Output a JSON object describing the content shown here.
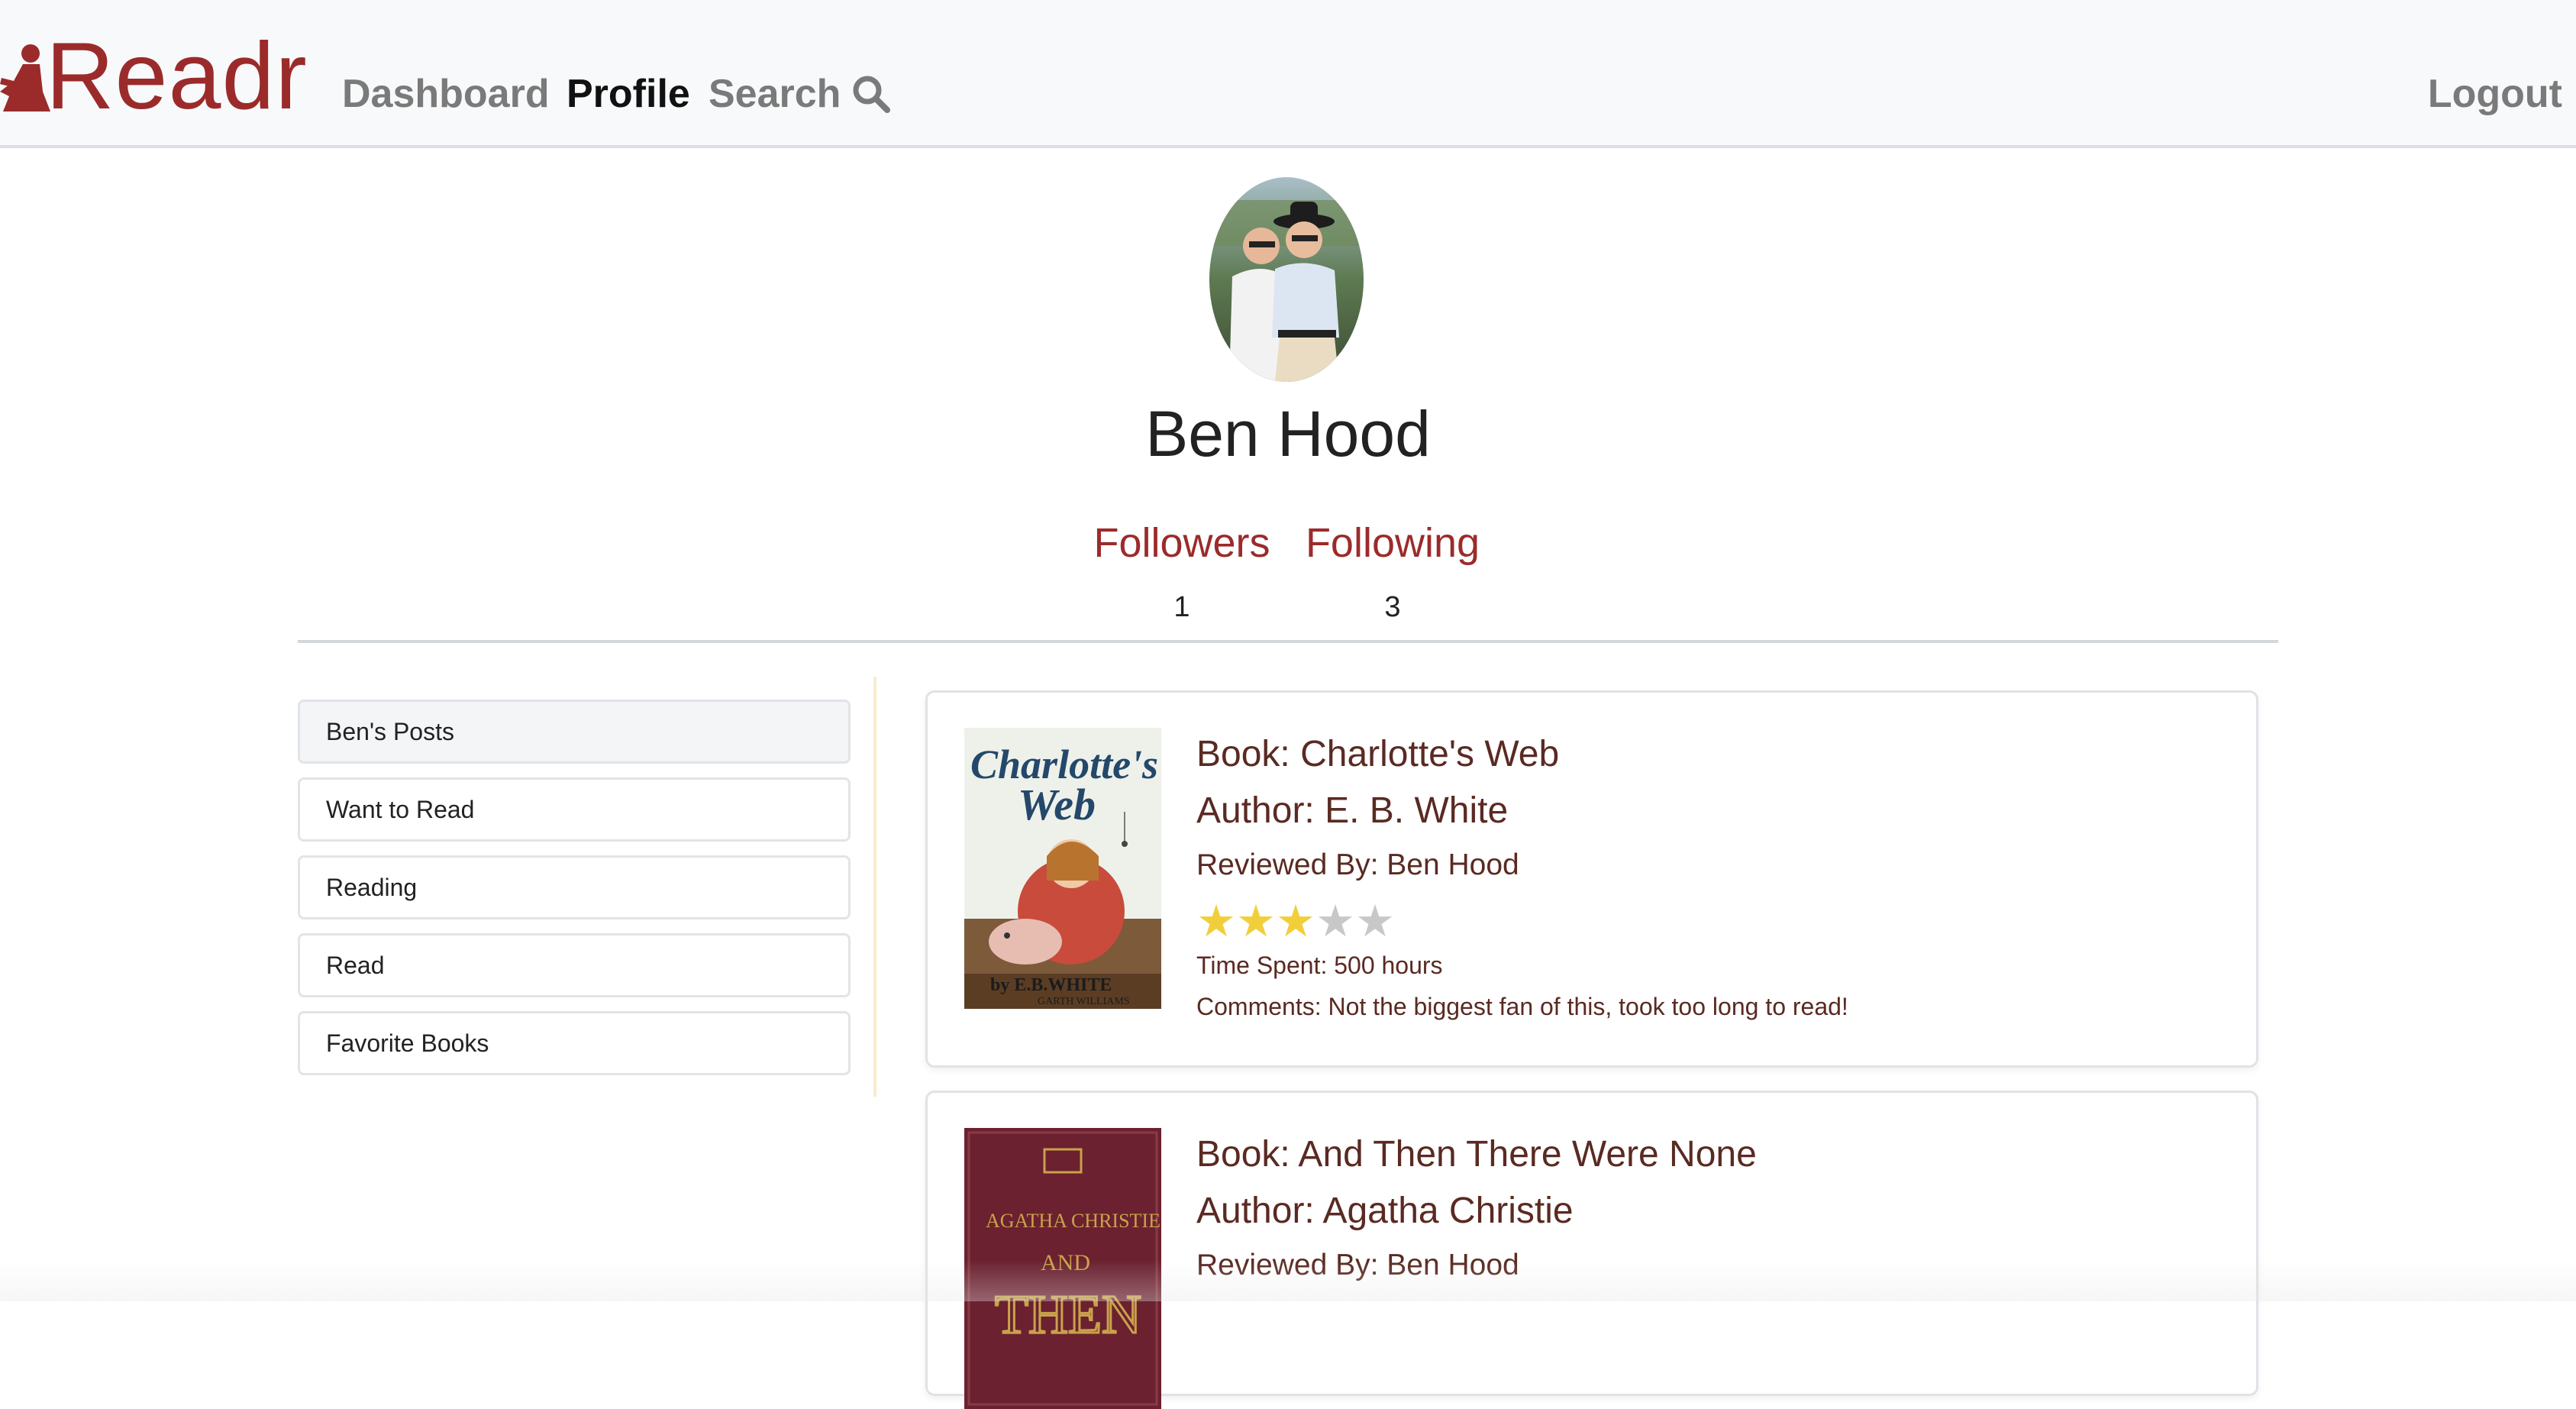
{
  "brand": {
    "name": "Readr",
    "color": "#9b2b2b"
  },
  "nav": {
    "dashboard": "Dashboard",
    "profile": "Profile",
    "search": "Search",
    "logout": "Logout"
  },
  "profile": {
    "name": "Ben Hood",
    "followers_label": "Followers",
    "followers_count": "1",
    "following_label": "Following",
    "following_count": "3"
  },
  "sidebar": {
    "items": [
      {
        "label": "Ben's Posts",
        "active": true
      },
      {
        "label": "Want to Read",
        "active": false
      },
      {
        "label": "Reading",
        "active": false
      },
      {
        "label": "Read",
        "active": false
      },
      {
        "label": "Favorite Books",
        "active": false
      }
    ]
  },
  "posts": [
    {
      "book": "Book: Charlotte's Web",
      "author": "Author: E. B. White",
      "reviewer": "Reviewed By: Ben Hood",
      "rating": 3,
      "rating_max": 5,
      "time_spent": "Time Spent: 500 hours",
      "comments": "Comments: Not the biggest fan of this, took too long to read!",
      "cover": {
        "title_line1": "Charlotte's",
        "title_line2": "Web",
        "byline": "by E.B.WHITE",
        "illustrator": "GARTH WILLIAMS"
      }
    },
    {
      "book": "Book: And Then There Were None",
      "author": "Author: Agatha Christie",
      "reviewer": "Reviewed By: Ben Hood",
      "cover": {
        "author": "AGATHA CHRISTIE",
        "title_part1": "AND",
        "title_part2": "THEN"
      }
    }
  ],
  "colors": {
    "accent": "#9b2b2b",
    "post_text": "#5a2a22",
    "star_on": "#f1cf3b",
    "star_off": "#c8c8c8"
  }
}
